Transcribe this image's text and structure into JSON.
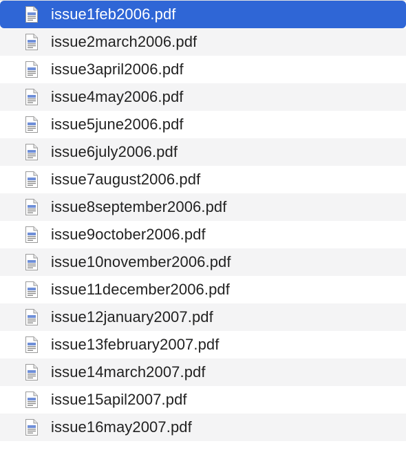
{
  "files": [
    {
      "name": "issue1feb2006.pdf",
      "selected": true,
      "icon": "pdf-file-icon"
    },
    {
      "name": "issue2march2006.pdf",
      "selected": false,
      "icon": "pdf-file-icon"
    },
    {
      "name": "issue3april2006.pdf",
      "selected": false,
      "icon": "pdf-file-icon"
    },
    {
      "name": "issue4may2006.pdf",
      "selected": false,
      "icon": "pdf-file-icon"
    },
    {
      "name": "issue5june2006.pdf",
      "selected": false,
      "icon": "pdf-file-icon"
    },
    {
      "name": "issue6july2006.pdf",
      "selected": false,
      "icon": "pdf-file-icon"
    },
    {
      "name": "issue7august2006.pdf",
      "selected": false,
      "icon": "pdf-file-icon"
    },
    {
      "name": "issue8september2006.pdf",
      "selected": false,
      "icon": "pdf-file-icon"
    },
    {
      "name": "issue9october2006.pdf",
      "selected": false,
      "icon": "pdf-file-icon"
    },
    {
      "name": "issue10november2006.pdf",
      "selected": false,
      "icon": "pdf-file-icon"
    },
    {
      "name": "issue11december2006.pdf",
      "selected": false,
      "icon": "pdf-file-icon"
    },
    {
      "name": "issue12january2007.pdf",
      "selected": false,
      "icon": "pdf-file-icon"
    },
    {
      "name": "issue13february2007.pdf",
      "selected": false,
      "icon": "pdf-file-icon"
    },
    {
      "name": "issue14march2007.pdf",
      "selected": false,
      "icon": "pdf-file-icon"
    },
    {
      "name": "issue15apil2007.pdf",
      "selected": false,
      "icon": "pdf-file-icon"
    },
    {
      "name": "issue16may2007.pdf",
      "selected": false,
      "icon": "pdf-file-icon"
    }
  ],
  "colors": {
    "selection": "#2f66d6",
    "alt_row": "#f4f4f5",
    "text": "#222222",
    "selected_text": "#ffffff"
  }
}
